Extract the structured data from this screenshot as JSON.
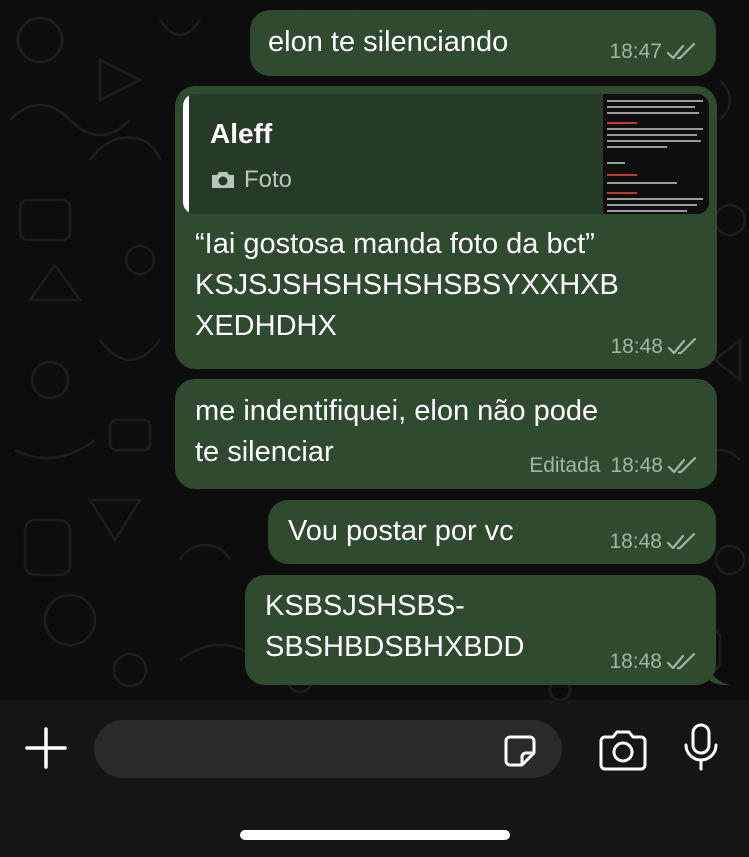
{
  "colors": {
    "bubble_outgoing": "#2f4a2f",
    "quote_background": "#263b26",
    "meta_text": "#a3b4a3",
    "composer_background": "#151515",
    "input_background": "#2a2a2a"
  },
  "messages": [
    {
      "text": "elon te silenciando",
      "time": "18:47"
    },
    {
      "reply": {
        "author": "Aleff",
        "kind": "Foto",
        "thumbnail_icon": "photo-thumbnail"
      },
      "text": "“Iai gostosa manda foto da bct”\nKSJSJSHSHSHSHSBSYXXHXB\nXEDHDHX",
      "time": "18:48"
    },
    {
      "text": "me indentifiquei, elon não pode\nte silenciar",
      "edited": "Editada",
      "time": "18:48"
    },
    {
      "text": "Vou postar por vc",
      "time": "18:48"
    },
    {
      "text": "KSBSJSHSBS-\nSBSHBDSBHXBDD",
      "time": "18:48"
    }
  ],
  "composer": {
    "attach_icon": "plus-icon",
    "sticker_icon": "sticker-icon",
    "camera_icon": "camera-icon",
    "mic_icon": "microphone-icon",
    "input_value": ""
  }
}
